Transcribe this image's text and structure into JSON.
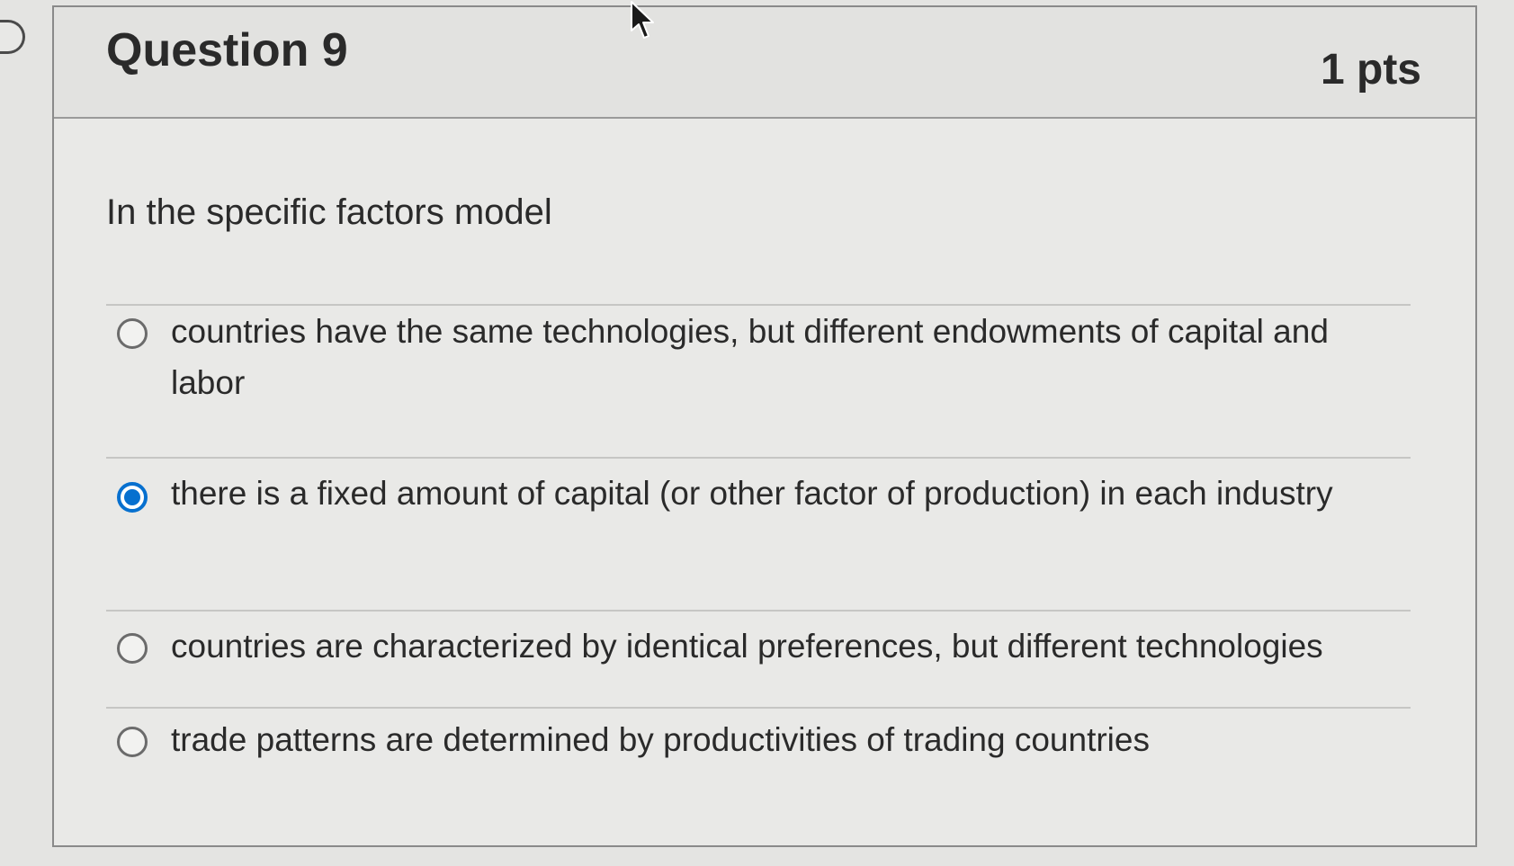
{
  "question": {
    "title": "Question 9",
    "points": "1 pts",
    "text": "In the specific factors model"
  },
  "answers": [
    {
      "label": "countries have the same technologies, but different endowments of capital and labor",
      "selected": false
    },
    {
      "label": "there is a fixed amount of capital (or other factor of production) in each industry",
      "selected": true
    },
    {
      "label": "countries are characterized by identical preferences, but different technologies",
      "selected": false
    },
    {
      "label": "trade patterns are determined by productivities of trading countries",
      "selected": false
    }
  ],
  "colors": {
    "selected_radio": "#0770cf",
    "text": "#2a2a2a"
  },
  "icons": {
    "cursor": "mouse-pointer-icon",
    "left_tab": "collapse-tab-icon"
  }
}
